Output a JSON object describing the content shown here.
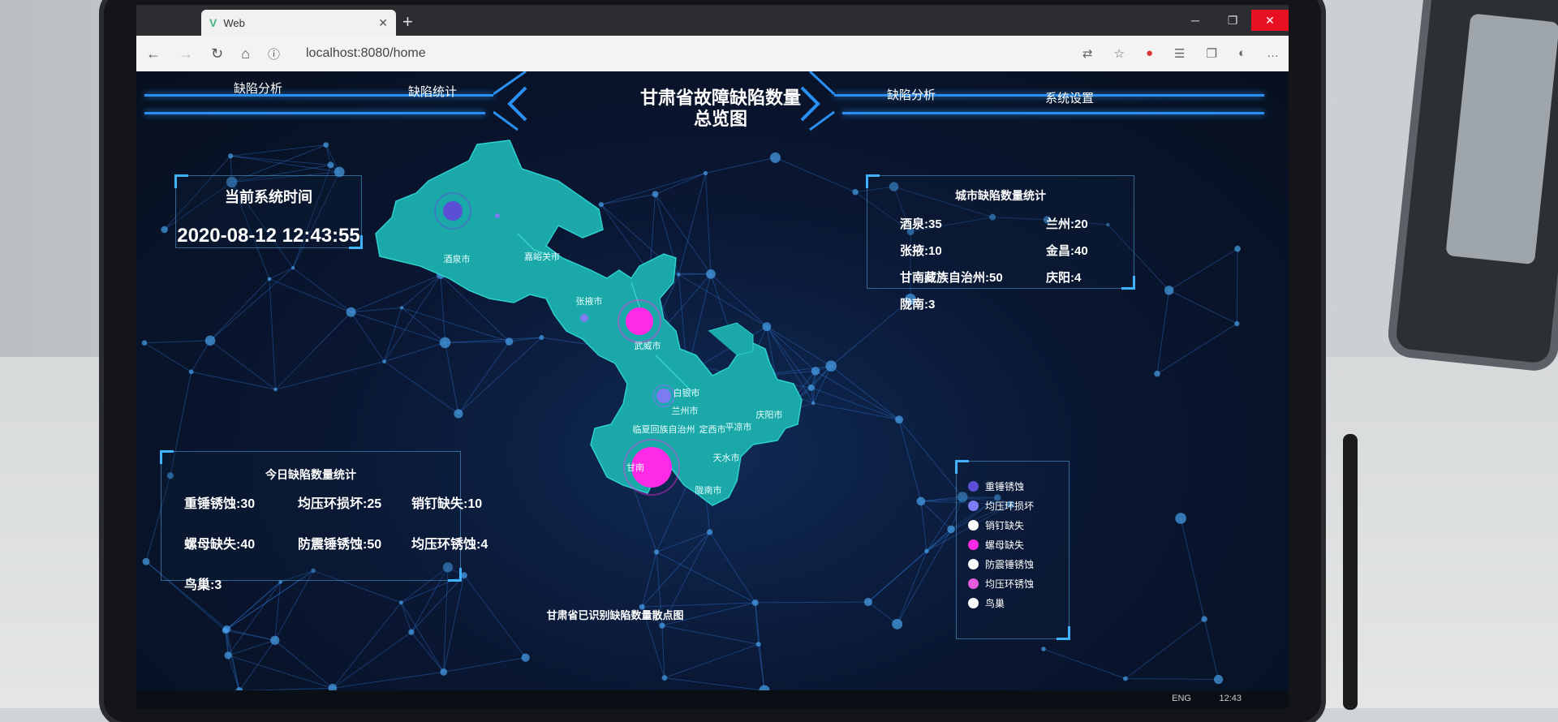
{
  "browser": {
    "tab_title": "Web",
    "tab_logo": "V",
    "tab_close": "✕",
    "new_tab": "+",
    "url": "localhost:8080/home",
    "controls": {
      "minimize": "─",
      "restore": "❐",
      "close": "✕"
    },
    "toolbar_icons": [
      "back-icon",
      "forward-icon",
      "reload-icon",
      "home-icon",
      "info-icon",
      "translate-icon",
      "favorite-icon",
      "extension-icon",
      "collections-icon",
      "profile-icon",
      "menu-icon"
    ]
  },
  "header": {
    "title": "甘肃省故障缺陷数量总览图",
    "nav_left": [
      "缺陷分析",
      "缺陷统计"
    ],
    "nav_right": [
      "缺陷分析",
      "系统设置"
    ]
  },
  "time_panel": {
    "label": "当前系统时间",
    "value": "2020-08-12 12:43:55"
  },
  "city_panel": {
    "title": "城市缺陷数量统计",
    "items": [
      "酒泉:35",
      "兰州:20",
      "张掖:10",
      "金昌:40",
      "甘南藏族自治州:50",
      "庆阳:4",
      "陇南:3"
    ]
  },
  "today_panel": {
    "title": "今日缺陷数量统计",
    "items": [
      "重锤锈蚀:30",
      "均压环损坏:25",
      "销钉缺失:10",
      "螺母缺失:40",
      "防震锤锈蚀:50",
      "均压环锈蚀:4",
      "鸟巢:3"
    ]
  },
  "map": {
    "cities": [
      "酒泉市",
      "嘉峪关市",
      "张掖市",
      "武威市",
      "白银市",
      "兰州市",
      "临夏回族自治州",
      "定西市",
      "平凉市",
      "庆阳市",
      "天水市",
      "陇南市",
      "甘南"
    ],
    "region_color": "#1aa8a8"
  },
  "legend": {
    "items": [
      {
        "label": "重锤锈蚀",
        "color": "#5b4fd6"
      },
      {
        "label": "均压环损坏",
        "color": "#7b7cf2"
      },
      {
        "label": "销钉缺失",
        "color": "#ffffff"
      },
      {
        "label": "螺母缺失",
        "color": "#ff2ae6"
      },
      {
        "label": "防震锤锈蚀",
        "color": "#ffffff"
      },
      {
        "label": "均压环锈蚀",
        "color": "#e85be0"
      },
      {
        "label": "鸟巢",
        "color": "#ffffff"
      }
    ]
  },
  "caption": "甘肃省已识别缺陷数量散点图",
  "taskbar": {
    "language": "ENG",
    "clock": "12:43"
  }
}
